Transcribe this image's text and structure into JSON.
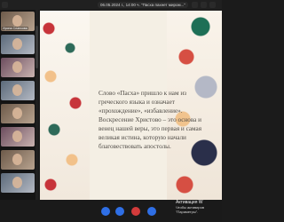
{
  "topbar": {
    "meeting_info": "06.05.2024 г., 14:00 ч. \"Пасха пахнет миром...\""
  },
  "participants": [
    {
      "name": "Ирина Сланкова"
    },
    {
      "name": ""
    },
    {
      "name": ""
    },
    {
      "name": ""
    },
    {
      "name": ""
    },
    {
      "name": ""
    },
    {
      "name": ""
    },
    {
      "name": ""
    }
  ],
  "slide": {
    "text": "Слово «Пасха» пришло к нам из греческого языка и означает «прохождение», «избавление». Воскресение Христово – это основа и венец нашей веры, это первая и самая великая истина, которую начали благовествовать апостолы."
  },
  "controls": {
    "mic": "mic",
    "camera": "camera",
    "leave": "leave",
    "more": "more"
  },
  "watermark": {
    "line1": "Активация W",
    "line2": "Чтобы активиров",
    "line3": "\"Параметры\"."
  }
}
